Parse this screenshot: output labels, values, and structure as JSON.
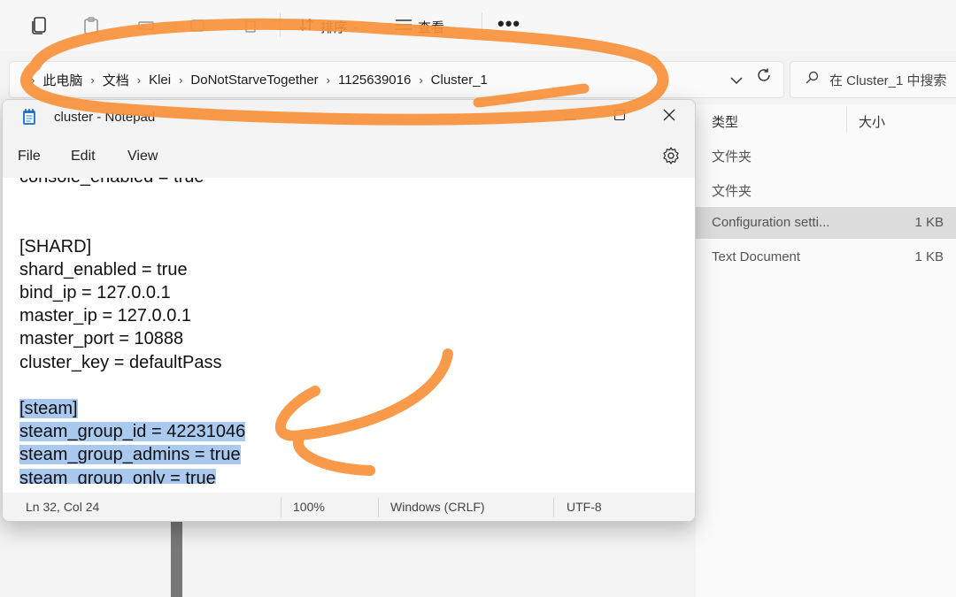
{
  "toolbar": {
    "sort_label": "排序",
    "view_label": "查看",
    "more_label": "•••"
  },
  "address": {
    "crumbs": [
      "此电脑",
      "文档",
      "Klei",
      "DoNotStarveTogether",
      "1125639016",
      "Cluster_1"
    ],
    "search_placeholder": "在 Cluster_1 中搜索"
  },
  "filelist": {
    "columns": {
      "type": "类型",
      "size": "大小"
    },
    "rows": [
      {
        "type": "文件夹",
        "size": ""
      },
      {
        "type": "文件夹",
        "size": ""
      },
      {
        "type": "Configuration setti...",
        "size": "1 KB",
        "selected": true
      },
      {
        "type": "Text Document",
        "size": "1 KB"
      }
    ]
  },
  "notepad": {
    "title": "cluster - Notepad",
    "menu": [
      "File",
      "Edit",
      "View"
    ],
    "lines": [
      {
        "text": "console_enabled = true",
        "hl": false
      },
      {
        "text": "",
        "hl": false
      },
      {
        "text": "",
        "hl": false
      },
      {
        "text": "[SHARD]",
        "hl": false
      },
      {
        "text": "shard_enabled = true",
        "hl": false
      },
      {
        "text": "bind_ip = 127.0.0.1",
        "hl": false
      },
      {
        "text": "master_ip = 127.0.0.1",
        "hl": false
      },
      {
        "text": "master_port = 10888",
        "hl": false
      },
      {
        "text": "cluster_key = defaultPass",
        "hl": false
      },
      {
        "text": "",
        "hl": false
      },
      {
        "text": "[steam]",
        "hl": true
      },
      {
        "text": "steam_group_id = 42231046",
        "hl": true
      },
      {
        "text": "steam_group_admins = true",
        "hl": true
      },
      {
        "text": "steam_group_only = true",
        "hl": true
      }
    ],
    "status": {
      "position": "Ln 32, Col 24",
      "zoom": "100%",
      "line_ending": "Windows (CRLF)",
      "encoding": "UTF-8"
    }
  },
  "colors": {
    "annotation": "#f7913a",
    "selection": "#a9c9ef",
    "accent": "#2b7bd8"
  }
}
